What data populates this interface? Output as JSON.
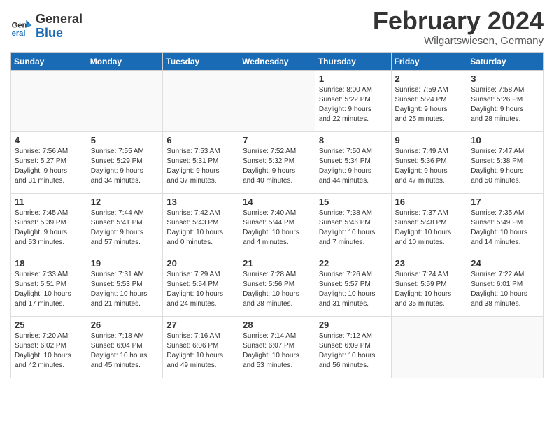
{
  "header": {
    "logo_line1": "General",
    "logo_line2": "Blue",
    "month_title": "February 2024",
    "location": "Wilgartswiesen, Germany"
  },
  "weekdays": [
    "Sunday",
    "Monday",
    "Tuesday",
    "Wednesday",
    "Thursday",
    "Friday",
    "Saturday"
  ],
  "weeks": [
    [
      {
        "day": "",
        "info": ""
      },
      {
        "day": "",
        "info": ""
      },
      {
        "day": "",
        "info": ""
      },
      {
        "day": "",
        "info": ""
      },
      {
        "day": "1",
        "info": "Sunrise: 8:00 AM\nSunset: 5:22 PM\nDaylight: 9 hours\nand 22 minutes."
      },
      {
        "day": "2",
        "info": "Sunrise: 7:59 AM\nSunset: 5:24 PM\nDaylight: 9 hours\nand 25 minutes."
      },
      {
        "day": "3",
        "info": "Sunrise: 7:58 AM\nSunset: 5:26 PM\nDaylight: 9 hours\nand 28 minutes."
      }
    ],
    [
      {
        "day": "4",
        "info": "Sunrise: 7:56 AM\nSunset: 5:27 PM\nDaylight: 9 hours\nand 31 minutes."
      },
      {
        "day": "5",
        "info": "Sunrise: 7:55 AM\nSunset: 5:29 PM\nDaylight: 9 hours\nand 34 minutes."
      },
      {
        "day": "6",
        "info": "Sunrise: 7:53 AM\nSunset: 5:31 PM\nDaylight: 9 hours\nand 37 minutes."
      },
      {
        "day": "7",
        "info": "Sunrise: 7:52 AM\nSunset: 5:32 PM\nDaylight: 9 hours\nand 40 minutes."
      },
      {
        "day": "8",
        "info": "Sunrise: 7:50 AM\nSunset: 5:34 PM\nDaylight: 9 hours\nand 44 minutes."
      },
      {
        "day": "9",
        "info": "Sunrise: 7:49 AM\nSunset: 5:36 PM\nDaylight: 9 hours\nand 47 minutes."
      },
      {
        "day": "10",
        "info": "Sunrise: 7:47 AM\nSunset: 5:38 PM\nDaylight: 9 hours\nand 50 minutes."
      }
    ],
    [
      {
        "day": "11",
        "info": "Sunrise: 7:45 AM\nSunset: 5:39 PM\nDaylight: 9 hours\nand 53 minutes."
      },
      {
        "day": "12",
        "info": "Sunrise: 7:44 AM\nSunset: 5:41 PM\nDaylight: 9 hours\nand 57 minutes."
      },
      {
        "day": "13",
        "info": "Sunrise: 7:42 AM\nSunset: 5:43 PM\nDaylight: 10 hours\nand 0 minutes."
      },
      {
        "day": "14",
        "info": "Sunrise: 7:40 AM\nSunset: 5:44 PM\nDaylight: 10 hours\nand 4 minutes."
      },
      {
        "day": "15",
        "info": "Sunrise: 7:38 AM\nSunset: 5:46 PM\nDaylight: 10 hours\nand 7 minutes."
      },
      {
        "day": "16",
        "info": "Sunrise: 7:37 AM\nSunset: 5:48 PM\nDaylight: 10 hours\nand 10 minutes."
      },
      {
        "day": "17",
        "info": "Sunrise: 7:35 AM\nSunset: 5:49 PM\nDaylight: 10 hours\nand 14 minutes."
      }
    ],
    [
      {
        "day": "18",
        "info": "Sunrise: 7:33 AM\nSunset: 5:51 PM\nDaylight: 10 hours\nand 17 minutes."
      },
      {
        "day": "19",
        "info": "Sunrise: 7:31 AM\nSunset: 5:53 PM\nDaylight: 10 hours\nand 21 minutes."
      },
      {
        "day": "20",
        "info": "Sunrise: 7:29 AM\nSunset: 5:54 PM\nDaylight: 10 hours\nand 24 minutes."
      },
      {
        "day": "21",
        "info": "Sunrise: 7:28 AM\nSunset: 5:56 PM\nDaylight: 10 hours\nand 28 minutes."
      },
      {
        "day": "22",
        "info": "Sunrise: 7:26 AM\nSunset: 5:57 PM\nDaylight: 10 hours\nand 31 minutes."
      },
      {
        "day": "23",
        "info": "Sunrise: 7:24 AM\nSunset: 5:59 PM\nDaylight: 10 hours\nand 35 minutes."
      },
      {
        "day": "24",
        "info": "Sunrise: 7:22 AM\nSunset: 6:01 PM\nDaylight: 10 hours\nand 38 minutes."
      }
    ],
    [
      {
        "day": "25",
        "info": "Sunrise: 7:20 AM\nSunset: 6:02 PM\nDaylight: 10 hours\nand 42 minutes."
      },
      {
        "day": "26",
        "info": "Sunrise: 7:18 AM\nSunset: 6:04 PM\nDaylight: 10 hours\nand 45 minutes."
      },
      {
        "day": "27",
        "info": "Sunrise: 7:16 AM\nSunset: 6:06 PM\nDaylight: 10 hours\nand 49 minutes."
      },
      {
        "day": "28",
        "info": "Sunrise: 7:14 AM\nSunset: 6:07 PM\nDaylight: 10 hours\nand 53 minutes."
      },
      {
        "day": "29",
        "info": "Sunrise: 7:12 AM\nSunset: 6:09 PM\nDaylight: 10 hours\nand 56 minutes."
      },
      {
        "day": "",
        "info": ""
      },
      {
        "day": "",
        "info": ""
      }
    ]
  ]
}
